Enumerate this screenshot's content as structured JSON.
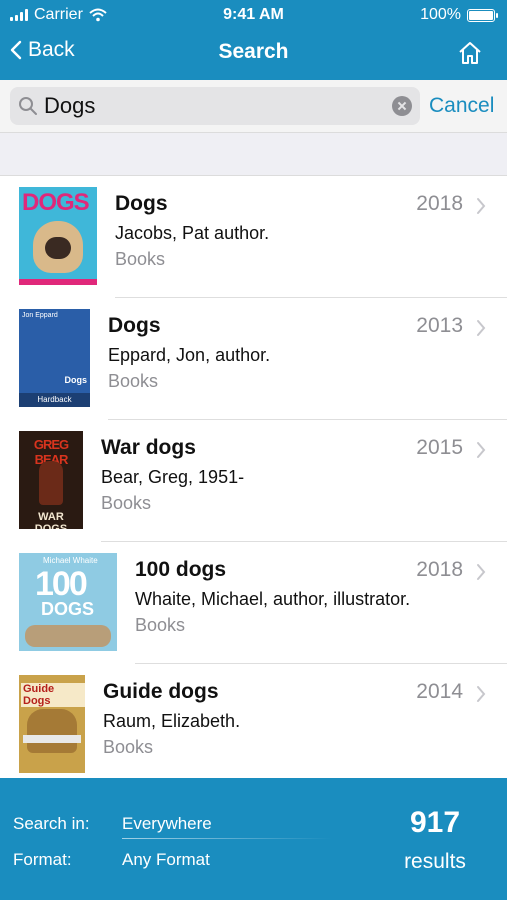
{
  "status": {
    "carrier": "Carrier",
    "time": "9:41 AM",
    "battery": "100%",
    "battery_level": 1.0
  },
  "nav": {
    "back_label": "Back",
    "title": "Search"
  },
  "search": {
    "query": "Dogs",
    "cancel_label": "Cancel"
  },
  "results": [
    {
      "title": "Dogs",
      "author": "Jacobs, Pat author.",
      "format": "Books",
      "year": "2018",
      "cover": {
        "text": "DOGS",
        "bg": "#3fb7d9",
        "accent": "#e0287a"
      }
    },
    {
      "title": "Dogs",
      "author": "Eppard, Jon, author.",
      "format": "Books",
      "year": "2013",
      "cover": {
        "top_text": "Jon Eppard",
        "mid_text": "Dogs",
        "bottom_text": "Hardback",
        "bg": "#2a5ea8"
      }
    },
    {
      "title": "War dogs",
      "author": "Bear, Greg, 1951-",
      "format": "Books",
      "year": "2015",
      "cover": {
        "top_text": "GREG BEAR",
        "bottom_text": "WAR DOGS",
        "bg": "#2a1a12",
        "accent": "#d8341e"
      }
    },
    {
      "title": "100 dogs",
      "author": "Whaite, Michael, author, illustrator.",
      "format": "Books",
      "year": "2018",
      "cover": {
        "top_text": "Michael Whaite",
        "mid_text": "100",
        "bottom_text": "DOGS",
        "bg": "#8fcbe3"
      }
    },
    {
      "title": "Guide dogs",
      "author": "Raum, Elizabeth.",
      "format": "Books",
      "year": "2014",
      "cover": {
        "top_text": "Guide Dogs",
        "bg": "#c9a24a"
      }
    }
  ],
  "footer": {
    "search_in_label": "Search in:",
    "search_in_value": "Everywhere",
    "format_label": "Format:",
    "format_value": "Any Format",
    "count": "917",
    "count_label": "results"
  },
  "colors": {
    "brand": "#1a8dbf",
    "link": "#1a8dbf",
    "secondary_text": "#8e8e93"
  }
}
